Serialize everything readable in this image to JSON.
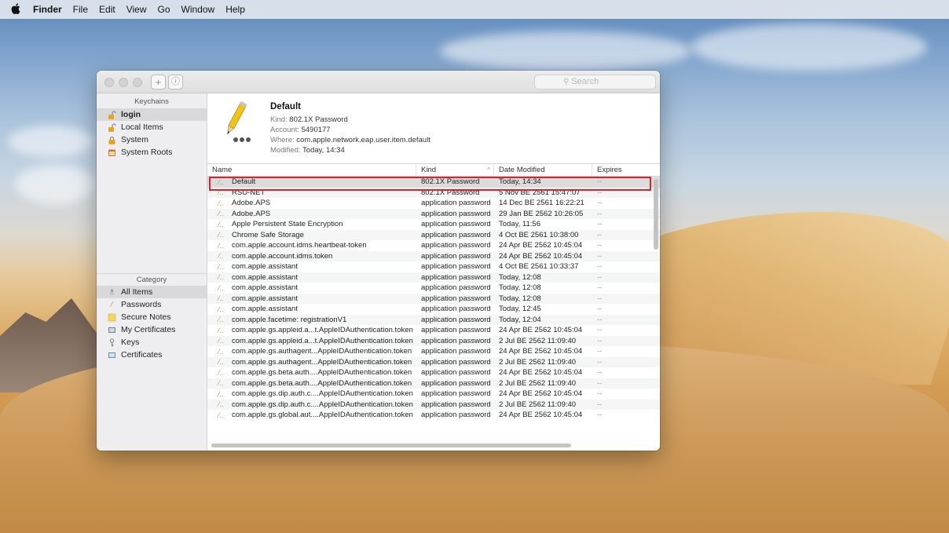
{
  "menubar": {
    "apple": "",
    "items": [
      "Finder",
      "File",
      "Edit",
      "View",
      "Go",
      "Window",
      "Help"
    ]
  },
  "window": {
    "add_label": "+",
    "info_label": "ⓘ",
    "search_placeholder": "Search"
  },
  "sidebar": {
    "keychains_header": "Keychains",
    "keychains": [
      {
        "label": "login",
        "icon": "unlocked-icon",
        "selected": true
      },
      {
        "label": "Local Items",
        "icon": "unlocked-icon"
      },
      {
        "label": "System",
        "icon": "locked-icon"
      },
      {
        "label": "System Roots",
        "icon": "cabinet-icon"
      }
    ],
    "category_header": "Category",
    "categories": [
      {
        "label": "All Items",
        "icon": "people-icon",
        "selected": true
      },
      {
        "label": "Passwords",
        "icon": "pen-icon"
      },
      {
        "label": "Secure Notes",
        "icon": "note-icon"
      },
      {
        "label": "My Certificates",
        "icon": "certificate-icon"
      },
      {
        "label": "Keys",
        "icon": "key-icon"
      },
      {
        "label": "Certificates",
        "icon": "certificate-icon"
      }
    ]
  },
  "detail": {
    "title": "Default",
    "kind_label": "Kind:",
    "kind_value": "802.1X Password",
    "account_label": "Account:",
    "account_value": "5490177",
    "where_label": "Where:",
    "where_value": "com.apple.network.eap.user.item.default",
    "modified_label": "Modified:",
    "modified_value": "Today, 14:34"
  },
  "table": {
    "columns": {
      "name": "Name",
      "kind": "Kind",
      "date": "Date Modified",
      "expires": "Expires"
    },
    "rows": [
      {
        "name": "Default",
        "kind": "802.1X Password",
        "date": "Today, 14:34",
        "expires": "--"
      },
      {
        "name": "RSU-NET",
        "kind": "802.1X Password",
        "date": "5 Nov BE 2561 15:47:07",
        "expires": "--"
      },
      {
        "name": "Adobe.APS",
        "kind": "application password",
        "date": "14 Dec BE 2561 16:22:21",
        "expires": "--"
      },
      {
        "name": "Adobe.APS",
        "kind": "application password",
        "date": "29 Jan BE 2562 10:26:05",
        "expires": "--"
      },
      {
        "name": "Apple Persistent State Encryption",
        "kind": "application password",
        "date": "Today, 11:56",
        "expires": "--"
      },
      {
        "name": "Chrome Safe Storage",
        "kind": "application password",
        "date": "4 Oct BE 2561 10:38:00",
        "expires": "--"
      },
      {
        "name": "com.apple.account.idms.heartbeat-token",
        "kind": "application password",
        "date": "24 Apr BE 2562 10:45:04",
        "expires": "--"
      },
      {
        "name": "com.apple.account.idms.token",
        "kind": "application password",
        "date": "24 Apr BE 2562 10:45:04",
        "expires": "--"
      },
      {
        "name": "com.apple.assistant",
        "kind": "application password",
        "date": "4 Oct BE 2561 10:33:37",
        "expires": "--"
      },
      {
        "name": "com.apple.assistant",
        "kind": "application password",
        "date": "Today, 12:08",
        "expires": "--"
      },
      {
        "name": "com.apple.assistant",
        "kind": "application password",
        "date": "Today, 12:08",
        "expires": "--"
      },
      {
        "name": "com.apple.assistant",
        "kind": "application password",
        "date": "Today, 12:08",
        "expires": "--"
      },
      {
        "name": "com.apple.assistant",
        "kind": "application password",
        "date": "Today, 12:45",
        "expires": "--"
      },
      {
        "name": "com.apple.facetime: registrationV1",
        "kind": "application password",
        "date": "Today, 12:04",
        "expires": "--"
      },
      {
        "name": "com.apple.gs.appleid.a...t.AppleIDAuthentication.token",
        "kind": "application password",
        "date": "24 Apr BE 2562 10:45:04",
        "expires": "--"
      },
      {
        "name": "com.apple.gs.appleid.a...t.AppleIDAuthentication.token",
        "kind": "application password",
        "date": "2 Jul BE 2562 11:09:40",
        "expires": "--"
      },
      {
        "name": "com.apple.gs.authagent...AppleIDAuthentication.token",
        "kind": "application password",
        "date": "24 Apr BE 2562 10:45:04",
        "expires": "--"
      },
      {
        "name": "com.apple.gs.authagent...AppleIDAuthentication.token",
        "kind": "application password",
        "date": "2 Jul BE 2562 11:09:40",
        "expires": "--"
      },
      {
        "name": "com.apple.gs.beta.auth....AppleIDAuthentication.token",
        "kind": "application password",
        "date": "24 Apr BE 2562 10:45:04",
        "expires": "--"
      },
      {
        "name": "com.apple.gs.beta.auth....AppleIDAuthentication.token",
        "kind": "application password",
        "date": "2 Jul BE 2562 11:09:40",
        "expires": "--"
      },
      {
        "name": "com.apple.gs.dip.auth.c....AppleIDAuthentication.token",
        "kind": "application password",
        "date": "24 Apr BE 2562 10:45:04",
        "expires": "--"
      },
      {
        "name": "com.apple.gs.dip.auth.c....AppleIDAuthentication.token",
        "kind": "application password",
        "date": "2 Jul BE 2562 11:09:40",
        "expires": "--"
      },
      {
        "name": "com.apple.gs.global.aut....AppleIDAuthentication.token",
        "kind": "application password",
        "date": "24 Apr BE 2562 10:45:04",
        "expires": "--"
      }
    ]
  }
}
